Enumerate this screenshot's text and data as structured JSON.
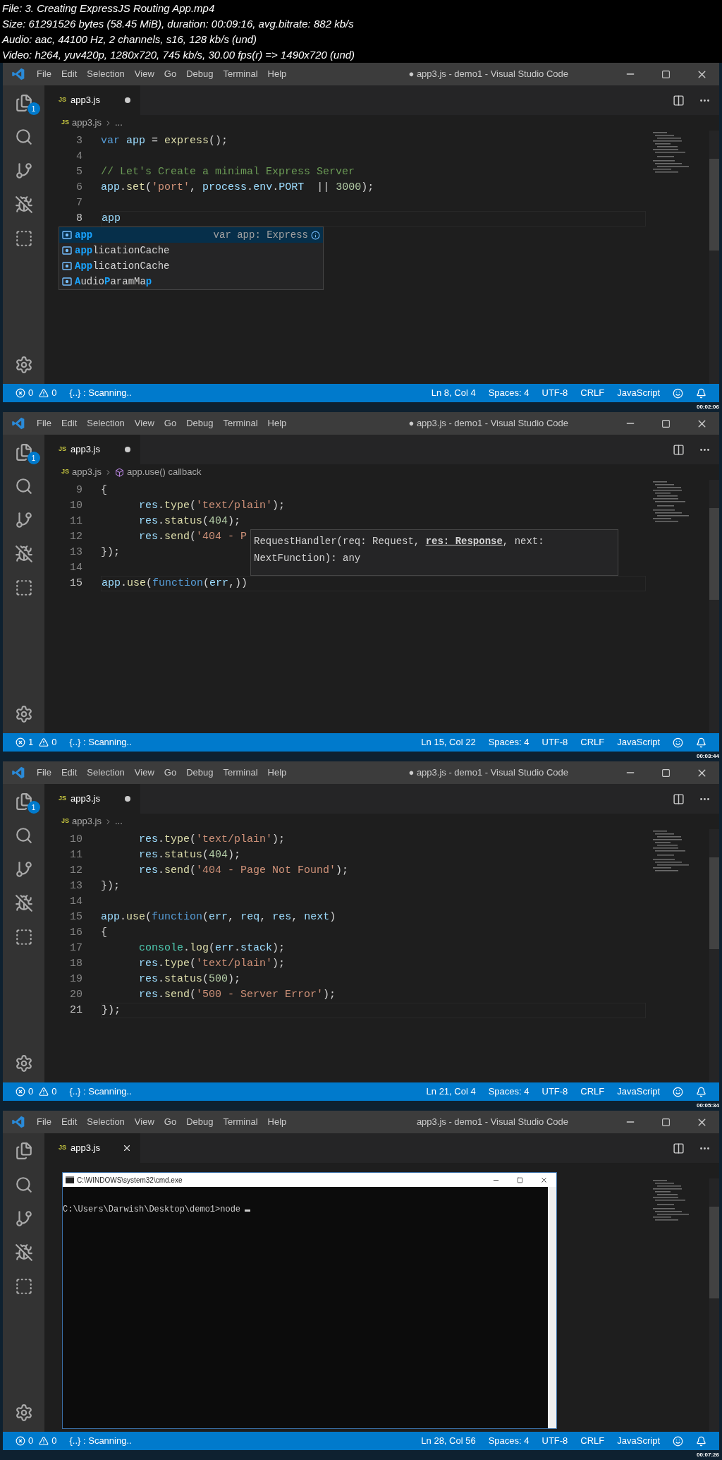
{
  "info": [
    "File: 3. Creating ExpressJS Routing App.mp4",
    "Size: 61291526 bytes (58.45 MiB), duration: 00:09:16, avg.bitrate: 882 kb/s",
    "Audio: aac, 44100 Hz, 2 channels, s16, 128 kb/s (und)",
    "Video: h264, yuv420p, 1280x720, 745 kb/s, 30.00 fps(r) => 1490x720 (und)"
  ],
  "frames": [
    {
      "menu": [
        "File",
        "Edit",
        "Selection",
        "View",
        "Go",
        "Debug",
        "Terminal",
        "Help"
      ],
      "window_title": "● app3.js - demo1 - Visual Studio Code",
      "tab": {
        "icon_text": "JS",
        "label": "app3.js",
        "dirty": true
      },
      "explorer_badge": "1",
      "breadcrumb": {
        "icon_text": "JS",
        "file": "app3.js",
        "symbol": "...",
        "symbol_icon": false
      },
      "lines": [
        {
          "number": "3",
          "current": false,
          "indent": false,
          "tokens": [
            {
              "text": "var ",
              "kind": "kw"
            },
            {
              "text": "app",
              "kind": "var"
            },
            {
              "text": " = ",
              "kind": "plain"
            },
            {
              "text": "express",
              "kind": "fn"
            },
            {
              "text": "();",
              "kind": "plain"
            }
          ]
        },
        {
          "number": "4",
          "current": false
        },
        {
          "number": "5",
          "current": false,
          "indent": false,
          "tokens": [
            {
              "text": "// Let's Create a minimal Express Server",
              "kind": "com"
            }
          ]
        },
        {
          "number": "6",
          "current": false,
          "indent": false,
          "tokens": [
            {
              "text": "app",
              "kind": "var"
            },
            {
              "text": ".",
              "kind": "plain"
            },
            {
              "text": "set",
              "kind": "fn"
            },
            {
              "text": "(",
              "kind": "plain"
            },
            {
              "text": "'port'",
              "kind": "str"
            },
            {
              "text": ", ",
              "kind": "plain"
            },
            {
              "text": "process",
              "kind": "var"
            },
            {
              "text": ".",
              "kind": "plain"
            },
            {
              "text": "env",
              "kind": "var"
            },
            {
              "text": ".",
              "kind": "plain"
            },
            {
              "text": "PORT",
              "kind": "var"
            },
            {
              "text": "  || ",
              "kind": "plain"
            },
            {
              "text": "3000",
              "kind": "num"
            },
            {
              "text": ");",
              "kind": "plain"
            }
          ]
        },
        {
          "number": "7",
          "current": false
        },
        {
          "number": "8",
          "current": true,
          "indent": false,
          "tokens": [
            {
              "text": "app",
              "kind": "var"
            }
          ]
        }
      ],
      "overlay": {
        "kind": "suggest",
        "items": [
          {
            "selected": true,
            "detail": "var app: Express",
            "segments": [
              {
                "text": "app",
                "match": true
              }
            ]
          },
          {
            "selected": false,
            "segments": [
              {
                "text": "app",
                "match": true
              },
              {
                "text": "licationCache",
                "match": false
              }
            ]
          },
          {
            "selected": false,
            "segments": [
              {
                "text": "App",
                "match": true
              },
              {
                "text": "licationCache",
                "match": false
              }
            ]
          },
          {
            "selected": false,
            "segments": [
              {
                "text": "A",
                "match": true
              },
              {
                "text": "udio",
                "match": false
              },
              {
                "text": "P",
                "match": true
              },
              {
                "text": "aramMa",
                "match": false
              },
              {
                "text": "p",
                "match": true
              }
            ]
          }
        ]
      },
      "status": {
        "errors": "0",
        "warnings": "0",
        "scanning": "{..} : Scanning..",
        "right": [
          "Ln 8, Col 4",
          "Spaces: 4",
          "UTF-8",
          "CRLF",
          "JavaScript"
        ]
      },
      "timestamp": "00:02:06"
    },
    {
      "menu": [
        "File",
        "Edit",
        "Selection",
        "View",
        "Go",
        "Debug",
        "Terminal",
        "Help"
      ],
      "window_title": "● app3.js - demo1 - Visual Studio Code",
      "tab": {
        "icon_text": "JS",
        "label": "app3.js",
        "dirty": true
      },
      "explorer_badge": "1",
      "breadcrumb": {
        "icon_text": "JS",
        "file": "app3.js",
        "symbol": "app.use() callback",
        "symbol_icon": true
      },
      "lines": [
        {
          "number": "9",
          "current": false,
          "indent": false,
          "tokens": [
            {
              "text": "{",
              "kind": "plain"
            }
          ]
        },
        {
          "number": "10",
          "current": false,
          "indent": true,
          "tokens": [
            {
              "text": "res",
              "kind": "var"
            },
            {
              "text": ".",
              "kind": "plain"
            },
            {
              "text": "type",
              "kind": "fn"
            },
            {
              "text": "(",
              "kind": "plain"
            },
            {
              "text": "'text/plain'",
              "kind": "str"
            },
            {
              "text": ");",
              "kind": "plain"
            }
          ]
        },
        {
          "number": "11",
          "current": false,
          "indent": true,
          "tokens": [
            {
              "text": "res",
              "kind": "var"
            },
            {
              "text": ".",
              "kind": "plain"
            },
            {
              "text": "status",
              "kind": "fn"
            },
            {
              "text": "(",
              "kind": "plain"
            },
            {
              "text": "404",
              "kind": "num"
            },
            {
              "text": ");",
              "kind": "plain"
            }
          ]
        },
        {
          "number": "12",
          "current": false,
          "indent": true,
          "tokens": [
            {
              "text": "res",
              "kind": "var"
            },
            {
              "text": ".",
              "kind": "plain"
            },
            {
              "text": "send",
              "kind": "fn"
            },
            {
              "text": "(",
              "kind": "plain"
            },
            {
              "text": "'404 - P",
              "kind": "str"
            }
          ]
        },
        {
          "number": "13",
          "current": false,
          "indent": false,
          "tokens": [
            {
              "text": "});",
              "kind": "plain"
            }
          ]
        },
        {
          "number": "14",
          "current": false
        },
        {
          "number": "15",
          "current": true,
          "indent": false,
          "tokens": [
            {
              "text": "app",
              "kind": "var"
            },
            {
              "text": ".",
              "kind": "plain"
            },
            {
              "text": "use",
              "kind": "fn"
            },
            {
              "text": "(",
              "kind": "plain"
            },
            {
              "text": "function",
              "kind": "kw"
            },
            {
              "text": "(",
              "kind": "plain"
            },
            {
              "text": "err",
              "kind": "var"
            },
            {
              "text": ",))",
              "kind": "plain"
            }
          ]
        }
      ],
      "overlay": {
        "kind": "hover",
        "text": "RequestHandler(req: Request, **res: Response**, next: NextFunction): any"
      },
      "status": {
        "errors": "1",
        "warnings": "0",
        "scanning": "{..} : Scanning..",
        "right": [
          "Ln 15, Col 22",
          "Spaces: 4",
          "UTF-8",
          "CRLF",
          "JavaScript"
        ]
      },
      "timestamp": "00:03:44"
    },
    {
      "menu": [
        "File",
        "Edit",
        "Selection",
        "View",
        "Go",
        "Debug",
        "Terminal",
        "Help"
      ],
      "window_title": "● app3.js - demo1 - Visual Studio Code",
      "tab": {
        "icon_text": "JS",
        "label": "app3.js",
        "dirty": true
      },
      "explorer_badge": "1",
      "breadcrumb": {
        "icon_text": "JS",
        "file": "app3.js",
        "symbol": "...",
        "symbol_icon": false
      },
      "lines": [
        {
          "number": "10",
          "current": false,
          "indent": true,
          "tokens": [
            {
              "text": "res",
              "kind": "var"
            },
            {
              "text": ".",
              "kind": "plain"
            },
            {
              "text": "type",
              "kind": "fn"
            },
            {
              "text": "(",
              "kind": "plain"
            },
            {
              "text": "'text/plain'",
              "kind": "str"
            },
            {
              "text": ");",
              "kind": "plain"
            }
          ]
        },
        {
          "number": "11",
          "current": false,
          "indent": true,
          "tokens": [
            {
              "text": "res",
              "kind": "var"
            },
            {
              "text": ".",
              "kind": "plain"
            },
            {
              "text": "status",
              "kind": "fn"
            },
            {
              "text": "(",
              "kind": "plain"
            },
            {
              "text": "404",
              "kind": "num"
            },
            {
              "text": ");",
              "kind": "plain"
            }
          ]
        },
        {
          "number": "12",
          "current": false,
          "indent": true,
          "tokens": [
            {
              "text": "res",
              "kind": "var"
            },
            {
              "text": ".",
              "kind": "plain"
            },
            {
              "text": "send",
              "kind": "fn"
            },
            {
              "text": "(",
              "kind": "plain"
            },
            {
              "text": "'404 - Page Not Found'",
              "kind": "str"
            },
            {
              "text": ");",
              "kind": "plain"
            }
          ]
        },
        {
          "number": "13",
          "current": false,
          "indent": false,
          "tokens": [
            {
              "text": "});",
              "kind": "plain"
            }
          ]
        },
        {
          "number": "14",
          "current": false
        },
        {
          "number": "15",
          "current": false,
          "indent": false,
          "tokens": [
            {
              "text": "app",
              "kind": "var"
            },
            {
              "text": ".",
              "kind": "plain"
            },
            {
              "text": "use",
              "kind": "fn"
            },
            {
              "text": "(",
              "kind": "plain"
            },
            {
              "text": "function",
              "kind": "kw"
            },
            {
              "text": "(",
              "kind": "plain"
            },
            {
              "text": "err",
              "kind": "var"
            },
            {
              "text": ", ",
              "kind": "plain"
            },
            {
              "text": "req",
              "kind": "var"
            },
            {
              "text": ", ",
              "kind": "plain"
            },
            {
              "text": "res",
              "kind": "var"
            },
            {
              "text": ", ",
              "kind": "plain"
            },
            {
              "text": "next",
              "kind": "var"
            },
            {
              "text": ")",
              "kind": "plain"
            }
          ]
        },
        {
          "number": "16",
          "current": false,
          "indent": false,
          "tokens": [
            {
              "text": "{",
              "kind": "plain"
            }
          ]
        },
        {
          "number": "17",
          "current": false,
          "indent": true,
          "tokens": [
            {
              "text": "console",
              "kind": "type"
            },
            {
              "text": ".",
              "kind": "plain"
            },
            {
              "text": "log",
              "kind": "fn"
            },
            {
              "text": "(",
              "kind": "plain"
            },
            {
              "text": "err",
              "kind": "var"
            },
            {
              "text": ".",
              "kind": "plain"
            },
            {
              "text": "stack",
              "kind": "var"
            },
            {
              "text": ");",
              "kind": "plain"
            }
          ]
        },
        {
          "number": "18",
          "current": false,
          "indent": true,
          "tokens": [
            {
              "text": "res",
              "kind": "var"
            },
            {
              "text": ".",
              "kind": "plain"
            },
            {
              "text": "type",
              "kind": "fn"
            },
            {
              "text": "(",
              "kind": "plain"
            },
            {
              "text": "'text/plain'",
              "kind": "str"
            },
            {
              "text": ");",
              "kind": "plain"
            }
          ]
        },
        {
          "number": "19",
          "current": false,
          "indent": true,
          "tokens": [
            {
              "text": "res",
              "kind": "var"
            },
            {
              "text": ".",
              "kind": "plain"
            },
            {
              "text": "status",
              "kind": "fn"
            },
            {
              "text": "(",
              "kind": "plain"
            },
            {
              "text": "500",
              "kind": "num"
            },
            {
              "text": ");",
              "kind": "plain"
            }
          ]
        },
        {
          "number": "20",
          "current": false,
          "indent": true,
          "tokens": [
            {
              "text": "res",
              "kind": "var"
            },
            {
              "text": ".",
              "kind": "plain"
            },
            {
              "text": "send",
              "kind": "fn"
            },
            {
              "text": "(",
              "kind": "plain"
            },
            {
              "text": "'500 - Server Error'",
              "kind": "str"
            },
            {
              "text": ");",
              "kind": "plain"
            }
          ]
        },
        {
          "number": "21",
          "current": true,
          "indent": false,
          "tokens": [
            {
              "text": "});",
              "kind": "plain"
            }
          ]
        }
      ],
      "status": {
        "errors": "0",
        "warnings": "0",
        "scanning": "{..} : Scanning..",
        "right": [
          "Ln 21, Col 4",
          "Spaces: 4",
          "UTF-8",
          "CRLF",
          "JavaScript"
        ]
      },
      "timestamp": "00:05:34"
    },
    {
      "menu": [
        "File",
        "Edit",
        "Selection",
        "View",
        "Go",
        "Debug",
        "Terminal",
        "Help"
      ],
      "window_title": "app3.js - demo1 - Visual Studio Code",
      "tab": {
        "icon_text": "JS",
        "label": "app3.js",
        "dirty": false
      },
      "overlay": {
        "kind": "terminal",
        "title": "C:\\WINDOWS\\system32\\cmd.exe",
        "prompt": "C:\\Users\\Darwish\\Desktop\\demo1>node"
      },
      "status": {
        "errors": "0",
        "warnings": "0",
        "scanning": "{..} : Scanning..",
        "right": [
          "Ln 28, Col 56",
          "Spaces: 4",
          "UTF-8",
          "CRLF",
          "JavaScript"
        ]
      },
      "timestamp": "00:07:26"
    }
  ]
}
